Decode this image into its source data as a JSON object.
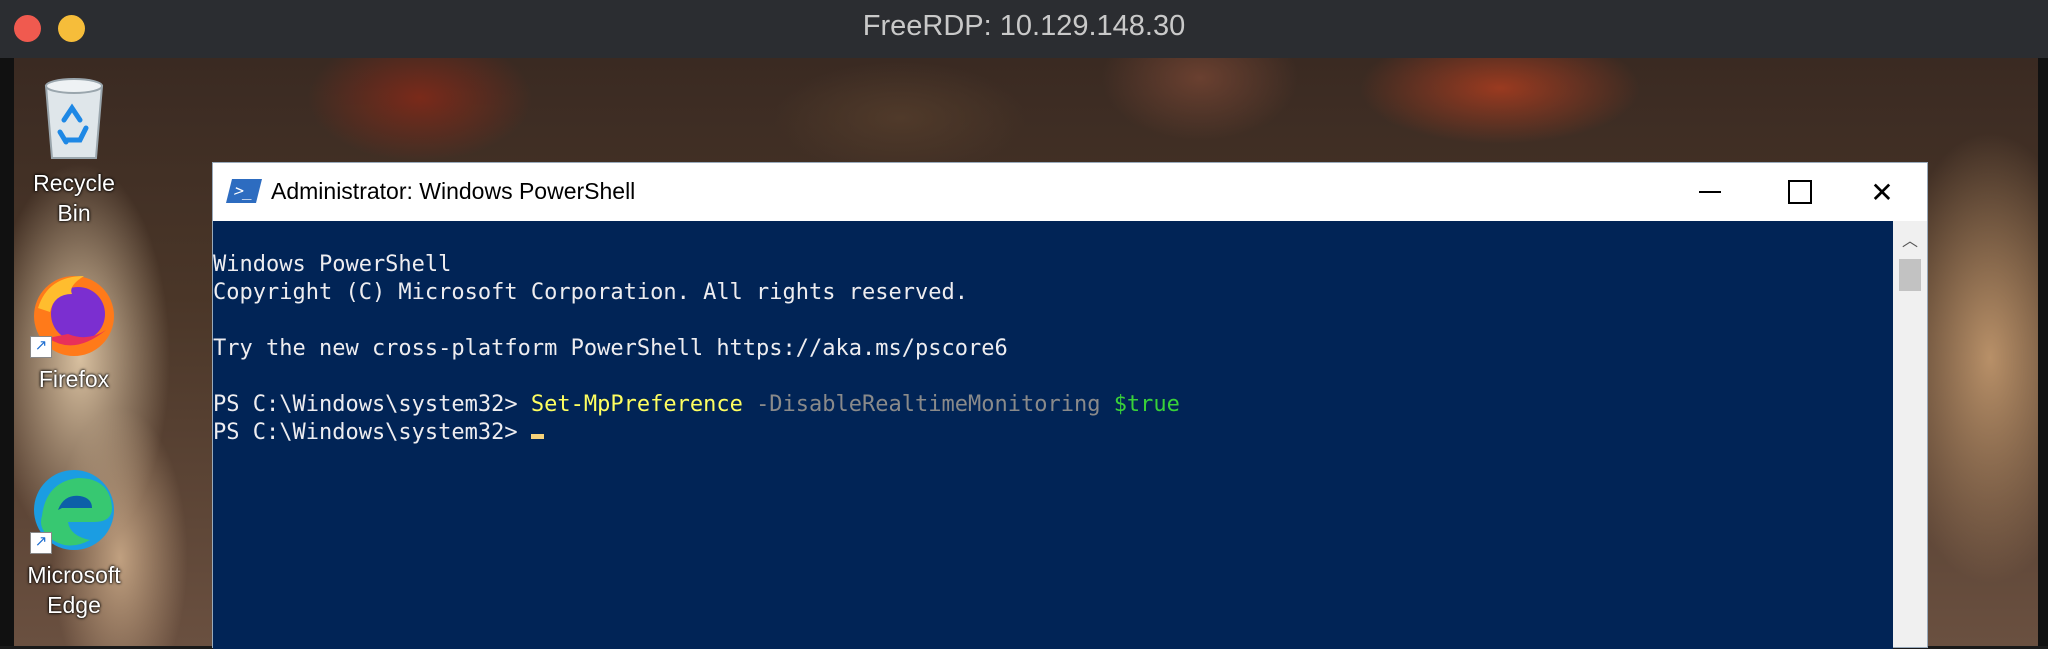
{
  "host": {
    "title": "FreeRDP: 10.129.148.30"
  },
  "desktop": {
    "icons": [
      {
        "label": "Recycle Bin",
        "icon": "recycle-bin-icon"
      },
      {
        "label": "Firefox",
        "icon": "firefox-icon"
      },
      {
        "label_line1": "Microsoft",
        "label_line2": "Edge",
        "icon": "edge-icon"
      }
    ]
  },
  "powershell": {
    "title": "Administrator: Windows PowerShell",
    "lines": [
      "Windows PowerShell",
      "Copyright (C) Microsoft Corporation. All rights reserved.",
      "",
      "Try the new cross-platform PowerShell https://aka.ms/pscore6",
      ""
    ],
    "prompt": "PS C:\\Windows\\system32> ",
    "command": {
      "cmdlet": "Set-MpPreference",
      "param": "-DisableRealtimeMonitoring",
      "value": "$true"
    }
  },
  "colors": {
    "console_bg": "#012456",
    "cmdlet": "#ffff60",
    "param": "#8a8a8a",
    "variable": "#39d139",
    "traffic_close": "#f05a4f",
    "traffic_min": "#f6bd3a"
  }
}
